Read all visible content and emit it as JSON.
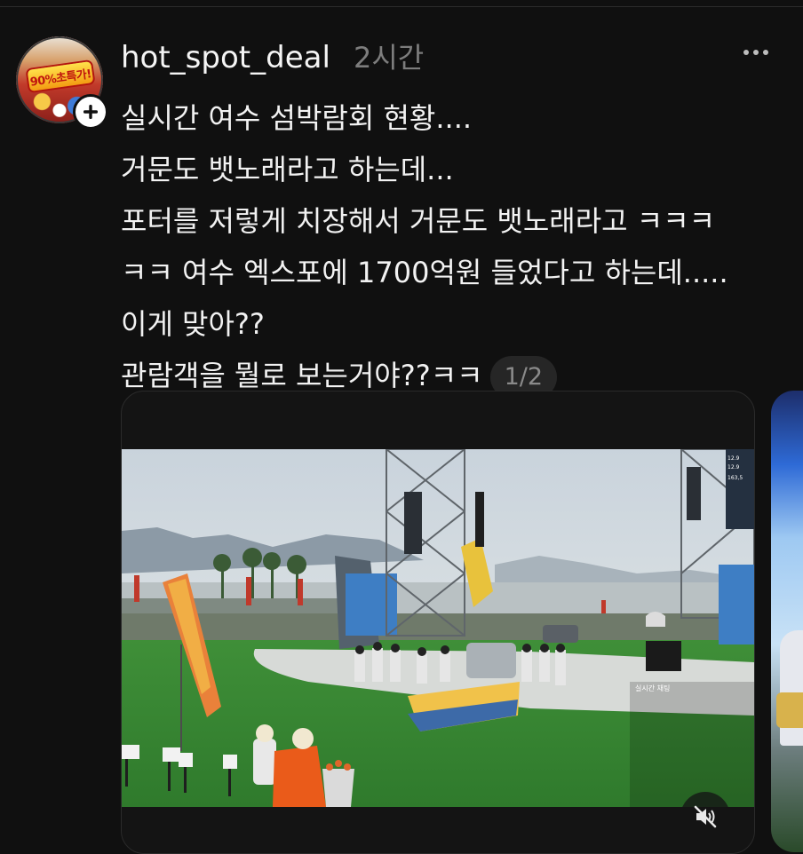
{
  "post": {
    "username": "hot_spot_deal",
    "time_ago": "2시간",
    "avatar_badge": "90%초특가!",
    "text_lines": [
      "실시간 여수 섬박람회  현황....",
      "거문도 뱃노래라고 하는데...",
      "포터를 저렇게 치장해서 거문도 뱃노래라고 ㅋㅋㅋ",
      "ㅋㅋ 여수 엑스포에 1700억원 들었다고 하는데.....",
      "이게 맞아??",
      "관람객을 뭘로 보는거야??ㅋㅋ"
    ],
    "page_indicator": "1/2"
  },
  "icons": {
    "more": "more-horizontal-icon",
    "follow": "plus-icon",
    "mute": "muted-speaker-icon"
  },
  "colors": {
    "background": "#101010",
    "text": "#f2f2f2",
    "muted_text": "#7d7d7d"
  }
}
